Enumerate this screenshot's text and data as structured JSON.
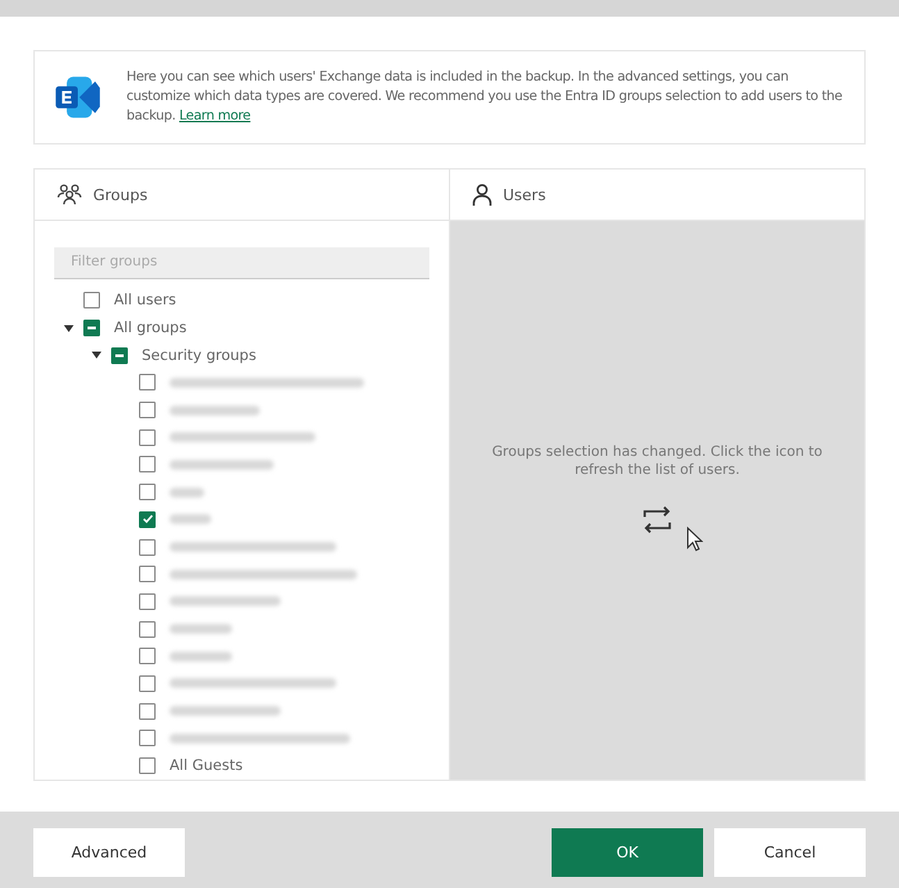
{
  "info": {
    "text": "Here you can see which users' Exchange data is included in the backup. In the advanced settings, you can customize which data types are covered. We recommend you use the Entra ID groups selection to add users to the backup.",
    "link": "Learn more"
  },
  "groups_panel": {
    "title": "Groups",
    "filter": {
      "placeholder": "Filter groups"
    },
    "tree": [
      {
        "kind": "text",
        "label": "All users",
        "checked": false
      },
      {
        "kind": "text",
        "label": "All groups",
        "partial": true,
        "expanded": true,
        "children": [
          {
            "kind": "text",
            "label": "Security groups",
            "partial": true,
            "expanded": true,
            "children": [
              {
                "kind": "redacted",
                "checked": false
              },
              {
                "kind": "redacted",
                "checked": false
              },
              {
                "kind": "redacted",
                "checked": false
              },
              {
                "kind": "redacted",
                "checked": false
              },
              {
                "kind": "redacted",
                "checked": false
              },
              {
                "kind": "redacted",
                "checked": true
              },
              {
                "kind": "redacted",
                "checked": false
              },
              {
                "kind": "redacted",
                "checked": false
              },
              {
                "kind": "redacted",
                "checked": false
              },
              {
                "kind": "redacted",
                "checked": false
              },
              {
                "kind": "redacted",
                "checked": false
              },
              {
                "kind": "redacted",
                "checked": false
              },
              {
                "kind": "redacted",
                "checked": false
              },
              {
                "kind": "redacted",
                "checked": false
              },
              {
                "kind": "text",
                "label": "All Guests",
                "checked": false
              }
            ]
          }
        ]
      }
    ]
  },
  "users_panel": {
    "title": "Users",
    "message": "Groups selection has changed. Click the icon to refresh the list of users."
  },
  "buttons": [
    {
      "label": "Advanced",
      "kind": "secondary"
    },
    {
      "label": "OK",
      "kind": "primary"
    },
    {
      "label": "Cancel",
      "kind": "secondary"
    }
  ]
}
